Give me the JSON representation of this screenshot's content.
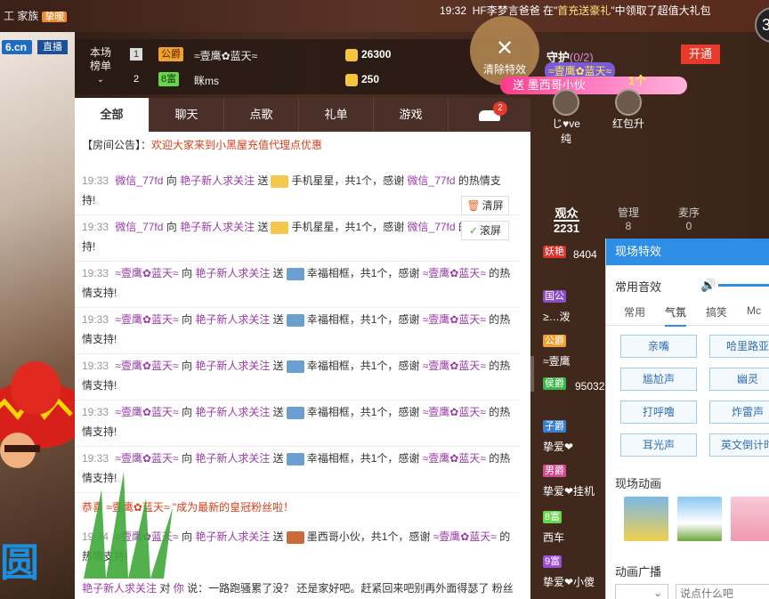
{
  "topbar": {
    "left_text": "工  家族",
    "left_badge": "挚暖",
    "time": "19:32",
    "announcement_pre": "HF李梦言爸爸 在\"",
    "announcement_highlight": "首充送豪礼",
    "announcement_post": "\"中领取了超值大礼包",
    "circle_label": "3"
  },
  "left": {
    "logo": "6.cn",
    "live_label": "直播",
    "big_text": "圆"
  },
  "rank": {
    "label": "本场\n榜单",
    "rows": [
      {
        "num": "1",
        "badge": "公爵",
        "badge_color": "#f0a030",
        "name": "≈壹鹰✿蓝天≈",
        "value": "26300"
      },
      {
        "num": "2",
        "badge": "8富",
        "badge_color": "#68d64a",
        "name": "眯ms",
        "value": "250"
      }
    ]
  },
  "clear_fx": {
    "icon": "✕",
    "label": "清除特效"
  },
  "chat": {
    "tabs": [
      {
        "label": "全部"
      },
      {
        "label": "聊天"
      },
      {
        "label": "点歌"
      },
      {
        "label": "礼单"
      },
      {
        "label": "游戏"
      },
      {
        "label": ""
      }
    ],
    "car_count": "2",
    "notice_label": "【房间公告】：",
    "notice_text": "欢迎大家来到小黑屋充值代理点优惠",
    "messages": [
      {
        "time": "19:33",
        "user": "微信_77fd",
        "to": "向",
        "target": "艳子新人求关注",
        "send": "送",
        "gift": "手机星星，共1个，感谢",
        "thanks_user": "微信_77fd",
        "tail": "的热情支持!"
      },
      {
        "time": "19:33",
        "user": "微信_77fd",
        "to": "向",
        "target": "艳子新人求关注",
        "send": "送",
        "gift": "手机星星，共1个，感谢",
        "thanks_user": "微信_77fd",
        "tail": "的热情支持!"
      },
      {
        "time": "19:33",
        "user": "≈壹鹰✿蓝天≈",
        "to": "向",
        "target": "艳子新人求关注",
        "send": "送",
        "gift": "幸福相框，共1个，感谢",
        "thanks_user": "≈壹鹰✿蓝天≈",
        "tail": "的热情支持!"
      },
      {
        "time": "19:33",
        "user": "≈壹鹰✿蓝天≈",
        "to": "向",
        "target": "艳子新人求关注",
        "send": "送",
        "gift": "幸福相框，共1个，感谢",
        "thanks_user": "≈壹鹰✿蓝天≈",
        "tail": "的热情支持!"
      },
      {
        "time": "19:33",
        "user": "≈壹鹰✿蓝天≈",
        "to": "向",
        "target": "艳子新人求关注",
        "send": "送",
        "gift": "幸福相框，共1个，感谢",
        "thanks_user": "≈壹鹰✿蓝天≈",
        "tail": "的热情支持!"
      },
      {
        "time": "19:33",
        "user": "≈壹鹰✿蓝天≈",
        "to": "向",
        "target": "艳子新人求关注",
        "send": "送",
        "gift": "幸福相框，共1个，感谢",
        "thanks_user": "≈壹鹰✿蓝天≈",
        "tail": "的热情支持!"
      },
      {
        "time": "19:33",
        "user": "≈壹鹰✿蓝天≈",
        "to": "向",
        "target": "艳子新人求关注",
        "send": "送",
        "gift": "幸福相框，共1个，感谢",
        "thanks_user": "≈壹鹰✿蓝天≈",
        "tail": "的热情支持!"
      }
    ],
    "fan_msg": "恭喜 ≈壹鹰✿蓝天≈ \"成为最新的皇冠粉丝啦！",
    "last_msg": {
      "time": "19:34",
      "user": "≈壹鹰✿蓝天≈",
      "to": "向",
      "target": "艳子新人求关注",
      "send": "送",
      "gift": "墨西哥小伙，共1个，感谢",
      "thanks_user": "≈壹鹰✿蓝天≈",
      "tail": "的热情支持!"
    },
    "clear_btn": "清屏",
    "scroll_btn": "滚屏",
    "bottom_user": "艳子新人求关注",
    "bottom_to": "对",
    "bottom_you": "你",
    "bottom_text": "说：一路跑骚累了没？ 还是家好吧。赶紧回来吧别再外面得瑟了 粉丝"
  },
  "guard": {
    "title": "守护",
    "count": "(0/2)",
    "open_btn": "开通",
    "avatars": [
      {
        "name": "じ♥ve纯"
      },
      {
        "name": "红包升"
      }
    ]
  },
  "promo": {
    "user": "≈壹鹰✿蓝天≈",
    "text": "送 墨西哥小伙",
    "count": "1个"
  },
  "audience": {
    "tabs": [
      {
        "label": "观众",
        "count": "2231"
      },
      {
        "label": "管理",
        "count": "8"
      },
      {
        "label": "麦序",
        "count": "0"
      }
    ],
    "rows": [
      {
        "badge": "妖艳",
        "badge_color": "#d8322b",
        "name": "8404"
      },
      {
        "badge": "国公",
        "badge_color": "#8b4cc7",
        "name": "≥…泼"
      },
      {
        "badge": "公爵",
        "badge_color": "#f0a030",
        "name": "≈壹鹰"
      },
      {
        "badge": "侯爵",
        "badge_color": "#3ab54a",
        "name": "95032"
      },
      {
        "badge": "子爵",
        "badge_color": "#3a7fd0",
        "name": "挚爱❤"
      },
      {
        "badge": "男爵",
        "badge_color": "#d44a8a",
        "name": "挚爱❤挂机"
      },
      {
        "badge": "8富",
        "badge_color": "#68d64a",
        "name": "西车"
      },
      {
        "badge": "9富",
        "badge_color": "#9a4ed8",
        "name": "挚爱❤小傻"
      }
    ]
  },
  "fx": {
    "title": "现场特效",
    "common_sound": "常用音效",
    "tabs": [
      "常用",
      "气氛",
      "搞笑",
      "Mc"
    ],
    "active_tab": "气氛",
    "buttons": [
      "亲嘴",
      "哈里路亚",
      "尴尬声",
      "幽灵",
      "打呼噜",
      "炸雷声",
      "耳光声",
      "英文倒计时"
    ],
    "anim_section": "现场动画",
    "broadcast_section": "动画广播",
    "input_placeholder": "说点什么吧"
  }
}
